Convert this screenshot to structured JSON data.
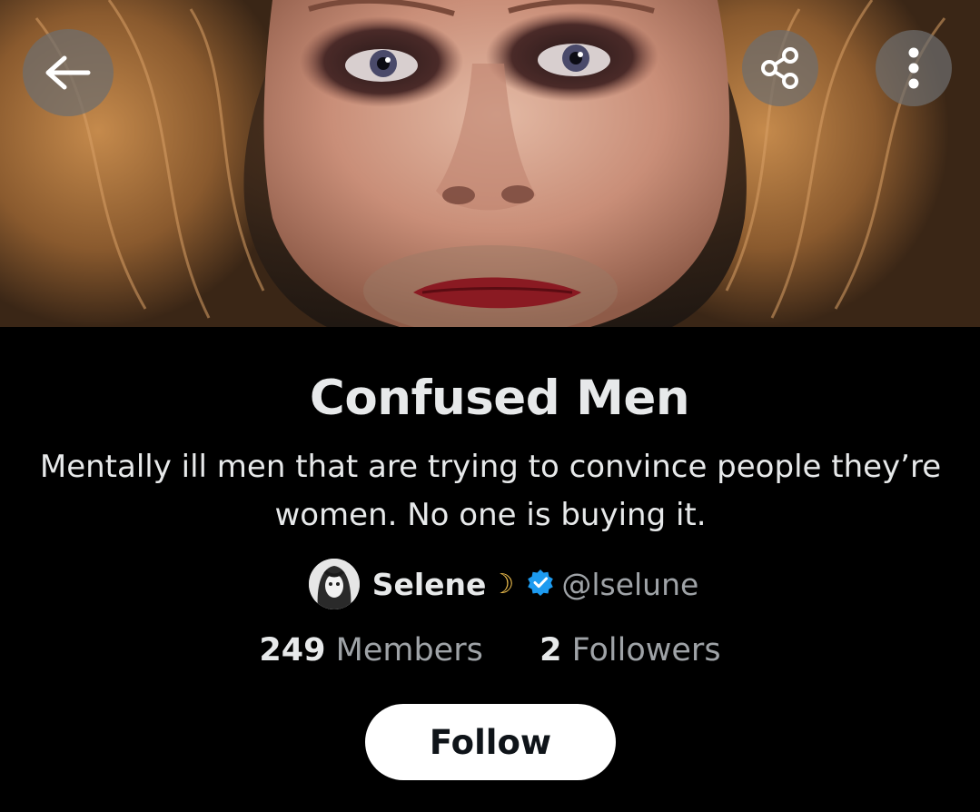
{
  "header": {
    "back_icon": "arrow-left-icon",
    "share_icon": "share-icon",
    "more_icon": "more-vertical-icon"
  },
  "community": {
    "name": "Confused Men",
    "description": "Mentally ill men that are trying to convince people they’re women. No one is buying it.",
    "owner_name": "Selene",
    "owner_emoji": "☽",
    "owner_verified_icon": "verified-badge-icon",
    "owner_handle": "@lselune",
    "members_count": "249",
    "members_label": "Members",
    "followers_count": "2",
    "followers_label": "Followers"
  },
  "actions": {
    "follow_label": "Follow"
  },
  "colors": {
    "background": "#000000",
    "text_primary": "#e7e9ea",
    "text_secondary": "#9fa3a7",
    "verified_blue": "#1d9bf0",
    "follow_button_bg": "#ffffff",
    "follow_button_text": "#0f1419"
  }
}
